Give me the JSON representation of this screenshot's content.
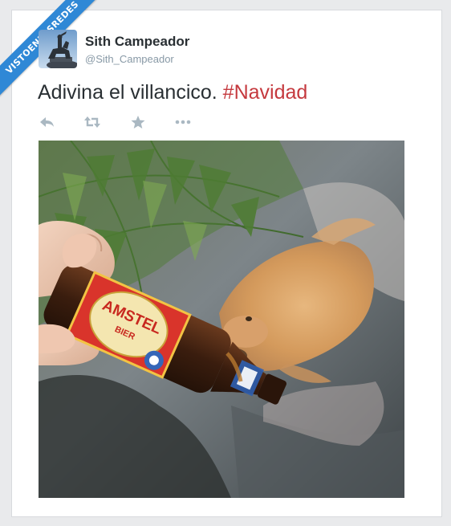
{
  "ribbon": {
    "text": "VISTOENLASREDES"
  },
  "tweet": {
    "author_name": "Sith Campeador",
    "author_handle": "@Sith_Campeador",
    "text": "Adivina el villancico.",
    "hashtag": "#Navidad"
  },
  "actions": [
    {
      "name": "reply-icon"
    },
    {
      "name": "retweet-icon"
    },
    {
      "name": "favorite-icon"
    },
    {
      "name": "more-icon"
    }
  ],
  "photo": {
    "bottle_label_brand": "AMSTEL",
    "bottle_label_sub": "BIER"
  },
  "colors": {
    "ribbon": "#2f88d6",
    "hashtag": "#c5393e",
    "action_icons": "#aab8c2"
  }
}
